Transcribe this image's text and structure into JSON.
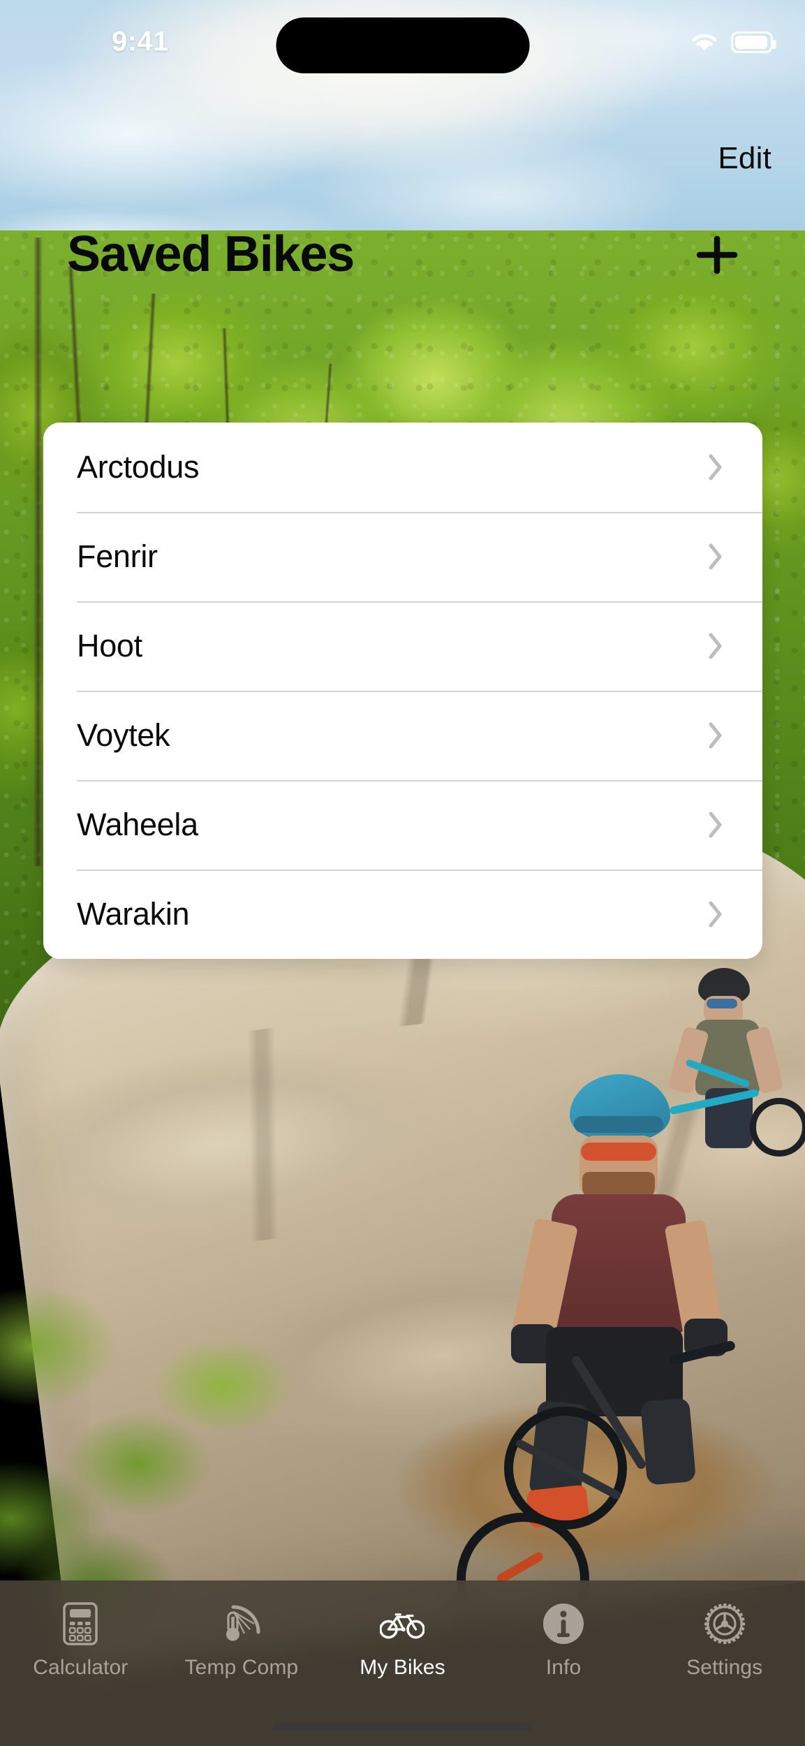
{
  "status_bar": {
    "time": "9:41",
    "wifi_icon": "wifi-icon",
    "battery_icon": "battery-icon",
    "dynamic_island": "dynamic-island"
  },
  "nav": {
    "edit_label": "Edit",
    "title": "Saved Bikes",
    "add_icon": "plus-icon"
  },
  "list": {
    "rows": [
      {
        "label": "Arctodus",
        "chevron": "chevron-right-icon"
      },
      {
        "label": "Fenrir",
        "chevron": "chevron-right-icon"
      },
      {
        "label": "Hoot",
        "chevron": "chevron-right-icon"
      },
      {
        "label": "Voytek",
        "chevron": "chevron-right-icon"
      },
      {
        "label": "Waheela",
        "chevron": "chevron-right-icon"
      },
      {
        "label": "Warakin",
        "chevron": "chevron-right-icon"
      }
    ]
  },
  "tab_bar": {
    "tabs": [
      {
        "label": "Calculator",
        "icon": "calculator-icon",
        "active": false
      },
      {
        "label": "Temp Comp",
        "icon": "thermometer-wheel-icon",
        "active": false
      },
      {
        "label": "My Bikes",
        "icon": "bicycle-icon",
        "active": true
      },
      {
        "label": "Info",
        "icon": "info-circle-icon",
        "active": false
      },
      {
        "label": "Settings",
        "icon": "chainring-gear-icon",
        "active": false
      }
    ]
  },
  "colors": {
    "card_background": "#ffffff",
    "row_text": "#0a0a0b",
    "chevron": "#bdbdc0",
    "separator": "#d3d3d6",
    "title_text": "#08090a",
    "tabbar_background": "#484136",
    "tab_inactive": "#a9a299",
    "tab_active": "#ffffff",
    "status_time": "#ffffff"
  },
  "background": {
    "scene": "mountain-bike-trail-photo"
  }
}
